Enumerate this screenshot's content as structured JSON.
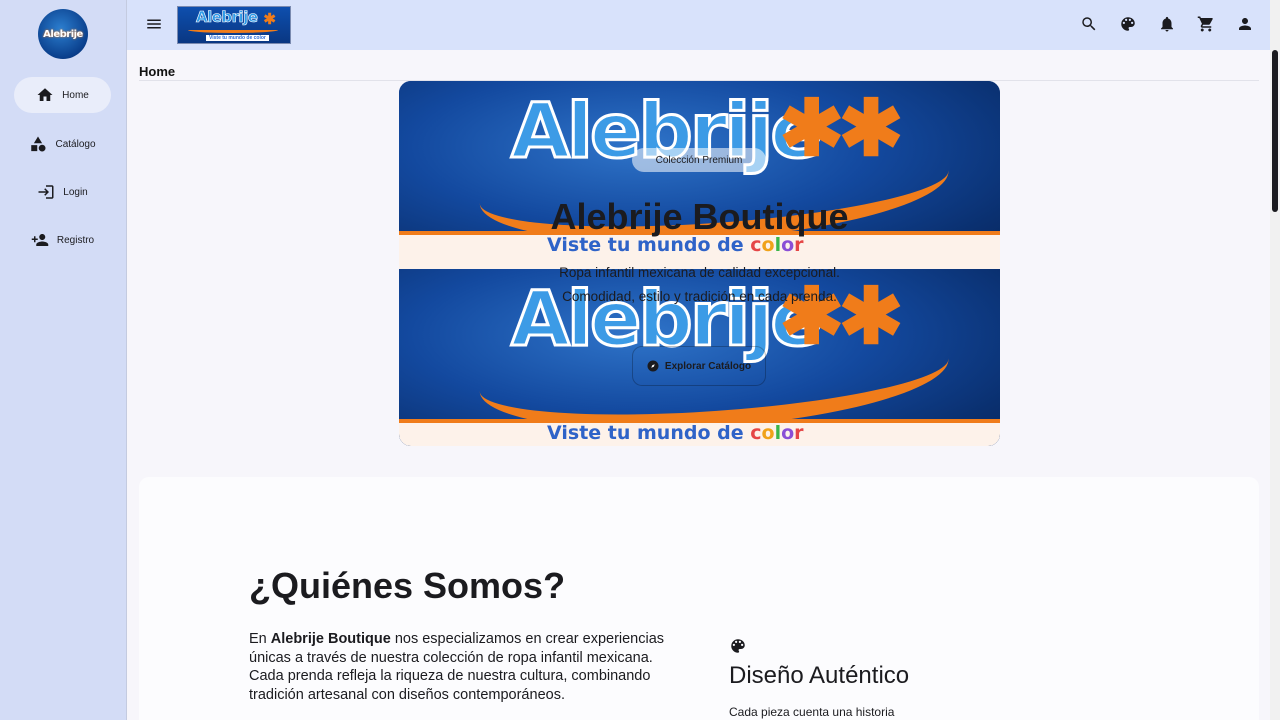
{
  "nav": {
    "logo_text": "Alebrije",
    "items": [
      {
        "label": "Home",
        "icon": "home-icon",
        "active": true
      },
      {
        "label": "Catálogo",
        "icon": "category-icon",
        "active": false
      },
      {
        "label": "Login",
        "icon": "login-icon",
        "active": false
      },
      {
        "label": "Registro",
        "icon": "person-add-icon",
        "active": false
      }
    ]
  },
  "topbar": {
    "logo_word": "Alebrije",
    "logo_tagline": "Viste tu mundo de color",
    "actions": [
      "search-icon",
      "palette-icon",
      "bell-icon",
      "cart-icon",
      "user-icon"
    ]
  },
  "breadcrumb": "Home",
  "hero": {
    "banner_word": "Alebrije",
    "banner_tagline_prefix": "Viste tu mundo de ",
    "banner_tagline_color_word": [
      "c",
      "o",
      "l",
      "o",
      "r"
    ],
    "chip": "Colección Premium",
    "title": "Alebrije Boutique",
    "subtitle_line1": "Ropa infantil mexicana de calidad excepcional.",
    "subtitle_line2": "Comodidad, estilo y tradición en cada prenda.",
    "cta": "Explorar Catálogo"
  },
  "about": {
    "title": "¿Quiénes Somos?",
    "text_prefix": "En ",
    "text_brand": "Alebrije Boutique",
    "text_rest": " nos especializamos en crear experiencias únicas a través de nuestra colección de ropa infantil mexicana. Cada prenda refleja la riqueza de nuestra cultura, combinando tradición artesanal con diseños contemporáneos.",
    "feature": {
      "icon": "palette-icon",
      "title": "Diseño Auténtico",
      "desc": "Cada pieza cuenta una historia"
    }
  },
  "colors": {
    "rail_bg": "#d3dcf6",
    "topbar_bg": "#d8e2fb",
    "brand_blue": "#3c9be6",
    "brand_orange": "#f07c1a"
  }
}
